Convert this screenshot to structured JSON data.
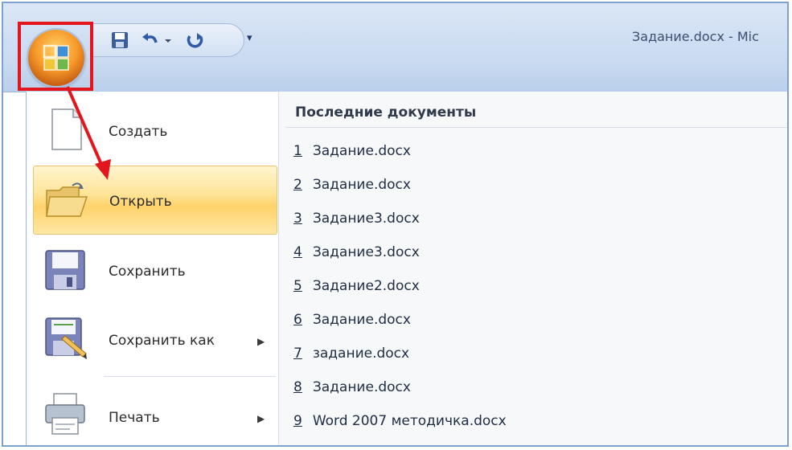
{
  "title": "Задание.docx - Mic",
  "quick_access": {
    "icons": [
      "save-icon",
      "undo-icon",
      "redo-icon"
    ],
    "customize_glyph": "▾"
  },
  "menu": {
    "items": [
      {
        "label": "Создать",
        "icon": "new-document-icon",
        "has_submenu": false
      },
      {
        "label": "Открыть",
        "icon": "open-folder-icon",
        "has_submenu": false,
        "active": true
      },
      {
        "label": "Сохранить",
        "icon": "save-floppy-icon",
        "has_submenu": false
      },
      {
        "label": "Сохранить как",
        "icon": "save-as-icon",
        "has_submenu": true
      },
      {
        "label": "Печать",
        "icon": "printer-icon",
        "has_submenu": true
      }
    ],
    "arrow_glyph": "▶"
  },
  "recent": {
    "title": "Последние документы",
    "items": [
      {
        "num": "1",
        "name": "Задание.docx"
      },
      {
        "num": "2",
        "name": "Задание.docx"
      },
      {
        "num": "3",
        "name": "Задание3.docx"
      },
      {
        "num": "4",
        "name": "Задание3.docx"
      },
      {
        "num": "5",
        "name": "Задание2.docx"
      },
      {
        "num": "6",
        "name": "Задание.docx"
      },
      {
        "num": "7",
        "name": "задание.docx"
      },
      {
        "num": "8",
        "name": "Задание.docx"
      },
      {
        "num": "9",
        "name": "Word 2007 методичка.docx"
      }
    ]
  },
  "colors": {
    "highlight_red": "#e4161d",
    "active_item": "#ffd36b",
    "frame_blue": "#7da2ce"
  }
}
